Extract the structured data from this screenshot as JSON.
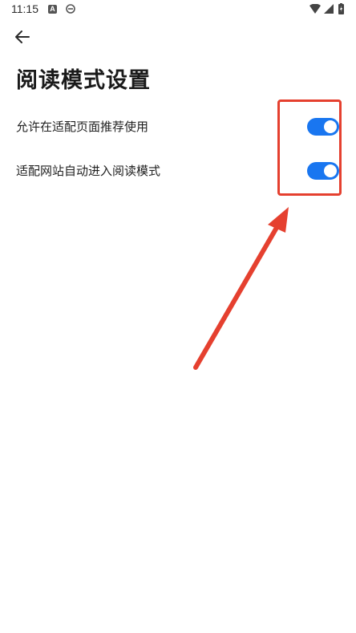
{
  "status_bar": {
    "time": "11:15",
    "icons": [
      "app-a-icon",
      "browser-e-icon",
      "wifi-icon",
      "signal-icon",
      "battery-icon"
    ]
  },
  "header": {
    "back_icon": "arrow-left-icon",
    "title": "阅读模式设置"
  },
  "settings": [
    {
      "label": "允许在适配页面推荐使用",
      "enabled": true
    },
    {
      "label": "适配网站自动进入阅读模式",
      "enabled": true
    }
  ],
  "colors": {
    "toggle_on": "#1976f0",
    "annotation": "#e5402f"
  }
}
